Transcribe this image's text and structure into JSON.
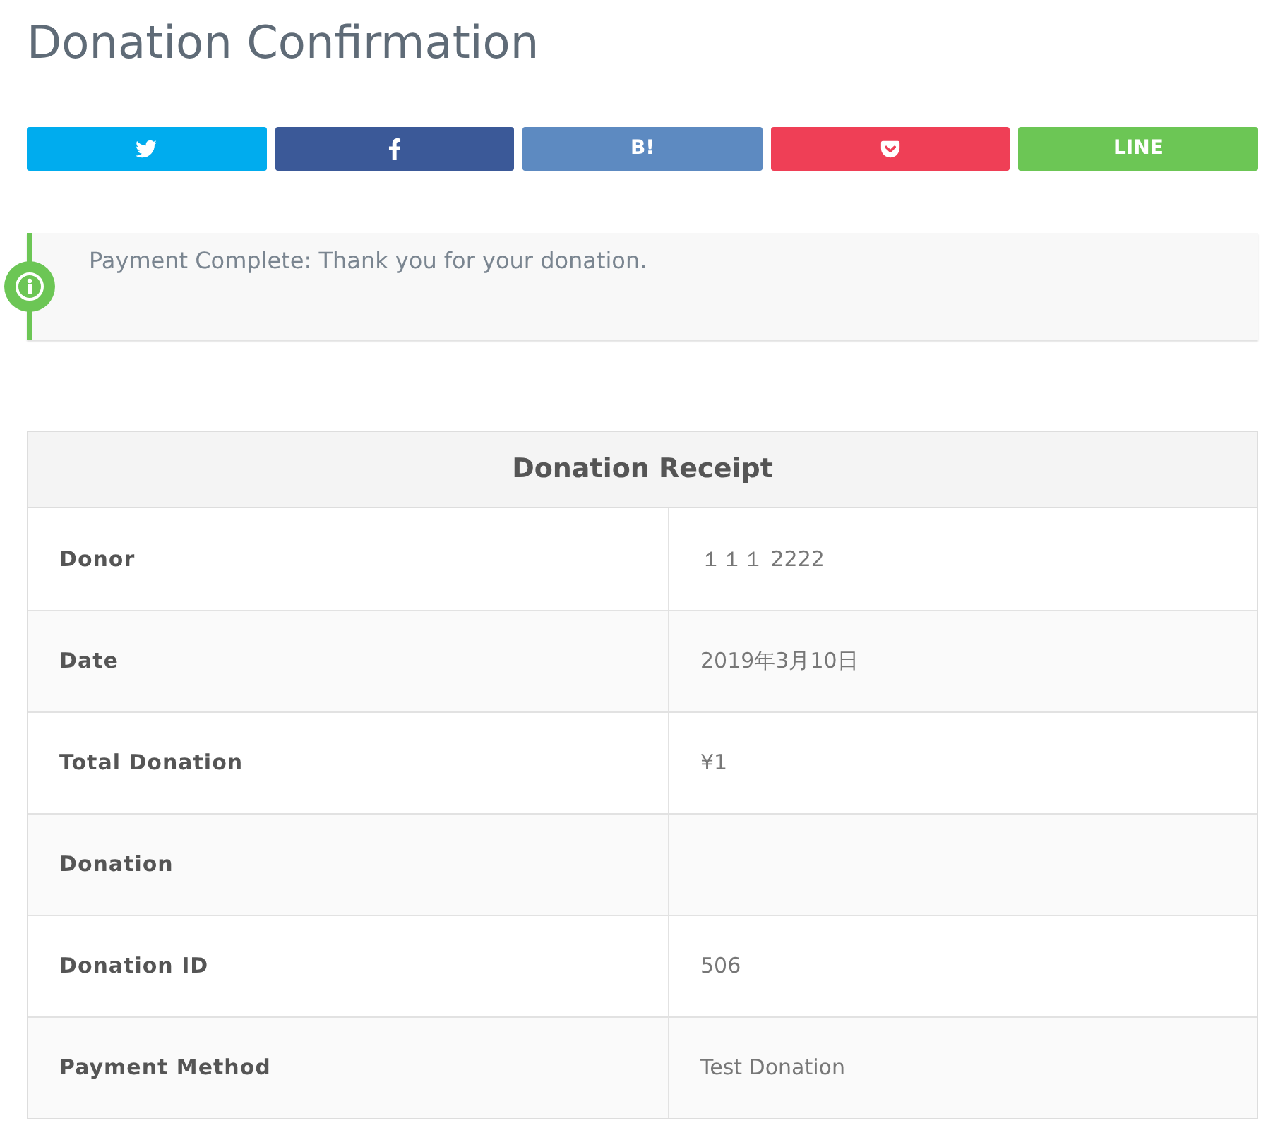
{
  "title": "Donation Confirmation",
  "share_buttons": [
    {
      "kind": "twitter",
      "color": "#00acee"
    },
    {
      "kind": "facebook",
      "color": "#3b5998"
    },
    {
      "kind": "text",
      "label": "B!",
      "color": "#5d8ac1"
    },
    {
      "kind": "pocket",
      "color": "#ef3f56"
    },
    {
      "kind": "text",
      "label": "LINE",
      "color": "#6cc655"
    }
  ],
  "notice": {
    "text": "Payment Complete: Thank you for your donation."
  },
  "receipt": {
    "title": "Donation Receipt",
    "rows": [
      {
        "label": "Donor",
        "value": "１１１ 2222"
      },
      {
        "label": "Date",
        "value": "2019年3月10日"
      },
      {
        "label": "Total Donation",
        "value": "¥1"
      },
      {
        "label": "Donation"
      },
      {
        "label": "Donation ID",
        "value": "506"
      },
      {
        "label": "Payment Method",
        "value": "Test Donation"
      }
    ]
  }
}
